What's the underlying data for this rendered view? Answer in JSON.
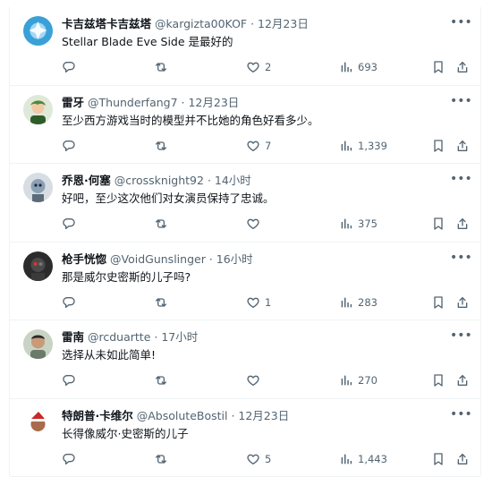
{
  "tweets": [
    {
      "name": "卡吉兹塔卡吉兹塔",
      "handle": "@kargizta00KOF",
      "sep": " · ",
      "time": "12月23日",
      "text": "Stellar Blade Eve Side 是最好的",
      "likes": "2",
      "views": "693",
      "avatar_color": "#3aa0d8"
    },
    {
      "name": "雷牙",
      "handle": "@Thunderfang7",
      "sep": " · ",
      "time": "12月23日",
      "text": "至少西方游戏当时的模型并不比她的角色好看多少。",
      "likes": "7",
      "views": "1,339",
      "avatar_color": "#4f8a3c"
    },
    {
      "name": "乔恩·何塞",
      "handle": "@crossknight92",
      "sep": " · ",
      "time": "14小时",
      "text": "好吧，至少这次他们对女演员保持了忠诚。",
      "likes": "",
      "views": "375",
      "avatar_color": "#8aa1b5"
    },
    {
      "name": "枪手恍惚",
      "handle": "@VoidGunslinger",
      "sep": " · ",
      "time": "16小时",
      "text": "那是威尔史密斯的儿子吗?",
      "likes": "1",
      "views": "283",
      "avatar_color": "#2b2b2b"
    },
    {
      "name": "雷南",
      "handle": "@rcduartte",
      "sep": " · ",
      "time": "17小时",
      "text": "选择从未如此简单!",
      "likes": "",
      "views": "270",
      "avatar_color": "#6b7b6a"
    },
    {
      "name": "特朗普·卡维尔",
      "handle": "@AbsoluteBostil",
      "sep": " · ",
      "time": "12月23日",
      "text": "长得像威尔·史密斯的儿子",
      "likes": "5",
      "views": "1,443",
      "avatar_color": "#c8282a"
    }
  ],
  "more_label": "•••",
  "colors": {
    "muted": "#536471",
    "text": "#0f1419",
    "border": "#eff3f4"
  }
}
